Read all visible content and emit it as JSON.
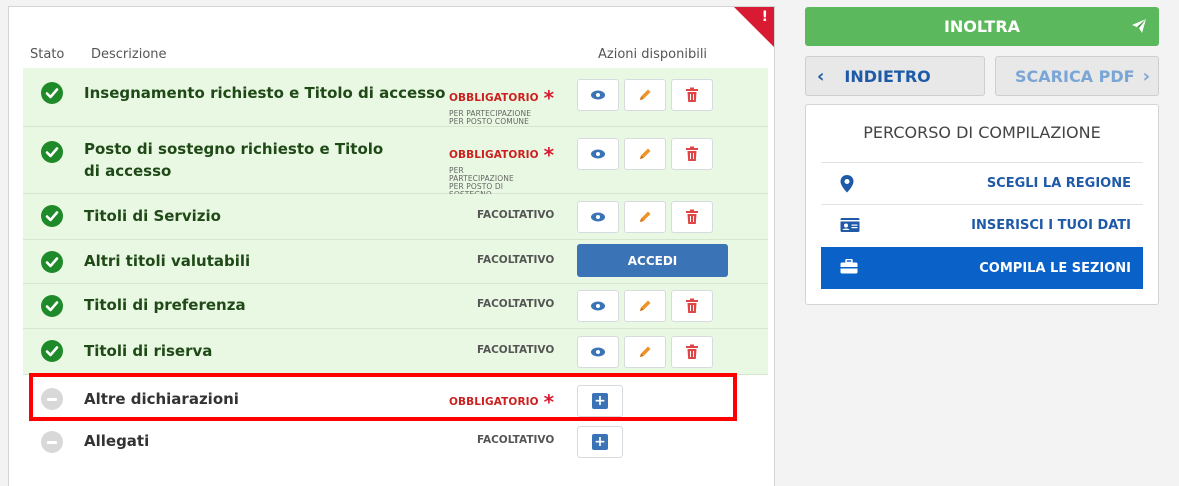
{
  "table": {
    "col_stato": "Stato",
    "col_descrizione": "Descrizione",
    "col_azioni": "Azioni disponibili",
    "rows": [
      {
        "label": "Insegnamento richiesto e Titolo di accesso",
        "requirement": "OBBLIGATORIO",
        "sub": "PER PARTECIPAZIONE PER POSTO COMUNE",
        "status": "complete"
      },
      {
        "label": "Posto di sostegno richiesto e Titolo di accesso",
        "requirement": "OBBLIGATORIO",
        "sub": "PER PARTECIPAZIONE PER POSTO DI SOSTEGNO",
        "status": "complete"
      },
      {
        "label": "Titoli di Servizio",
        "requirement": "FACOLTATIVO",
        "status": "complete"
      },
      {
        "label": "Altri titoli valutabili",
        "requirement": "FACOLTATIVO",
        "status": "complete",
        "action": "ACCEDI"
      },
      {
        "label": "Titoli di preferenza",
        "requirement": "FACOLTATIVO",
        "status": "complete"
      },
      {
        "label": "Titoli di riserva",
        "requirement": "FACOLTATIVO",
        "status": "complete"
      },
      {
        "label": "Altre dichiarazioni",
        "requirement": "OBBLIGATORIO",
        "status": "pending"
      },
      {
        "label": "Allegati",
        "requirement": "FACOLTATIVO",
        "status": "pending"
      }
    ]
  },
  "corner_mark": "!",
  "right": {
    "inoltra": "INOLTRA",
    "indietro": "INDIETRO",
    "scarica_pdf": "SCARICA PDF",
    "percorso_title": "PERCORSO DI COMPILAZIONE",
    "steps": [
      {
        "label": "SCEGLI LA REGIONE",
        "icon": "map-marker-icon"
      },
      {
        "label": "INSERISCI I TUOI DATI",
        "icon": "id-card-icon"
      },
      {
        "label": "COMPILA LE SEZIONI",
        "icon": "briefcase-icon"
      }
    ]
  },
  "colors": {
    "success": "#1f8a2a",
    "row_bg": "#e9f8e2",
    "primary": "#3a73b6",
    "inoltra": "#5cb85c",
    "active_step": "#0a62c9",
    "required": "#cc1f1f",
    "highlight": "#ff0000"
  }
}
